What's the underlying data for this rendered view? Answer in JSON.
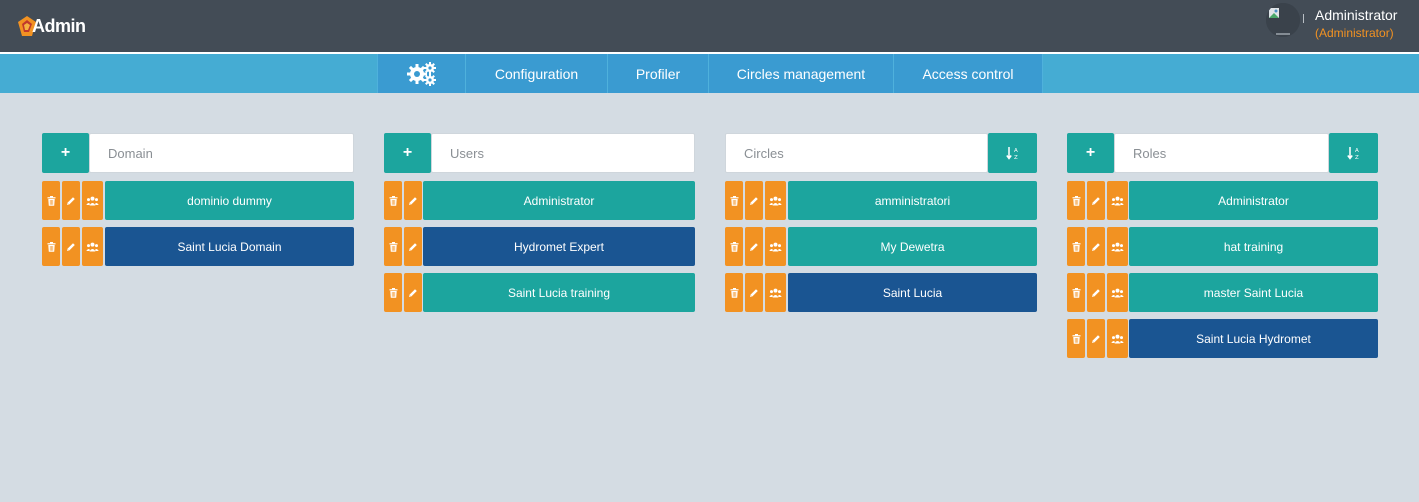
{
  "header": {
    "logo_text": "Admin",
    "user_name": "Administrator",
    "user_role": "(Administrator)"
  },
  "nav": {
    "gear_icon": "gears-icon",
    "items": [
      "Configuration",
      "Profiler",
      "Circles management",
      "Access control"
    ]
  },
  "columns": {
    "domain": {
      "placeholder": "Domain",
      "items": [
        {
          "label": "dominio dummy",
          "selected": false
        },
        {
          "label": "Saint Lucia Domain",
          "selected": true
        }
      ]
    },
    "users": {
      "placeholder": "Users",
      "items": [
        {
          "label": "Administrator",
          "selected": false
        },
        {
          "label": "Hydromet Expert",
          "selected": true
        },
        {
          "label": "Saint Lucia training",
          "selected": false
        }
      ]
    },
    "circles": {
      "placeholder": "Circles",
      "items": [
        {
          "label": "amministratori",
          "selected": false
        },
        {
          "label": "My Dewetra",
          "selected": false
        },
        {
          "label": "Saint Lucia",
          "selected": true
        }
      ]
    },
    "roles": {
      "placeholder": "Roles",
      "items": [
        {
          "label": "Administrator",
          "selected": false
        },
        {
          "label": "hat training",
          "selected": false
        },
        {
          "label": "master Saint Lucia",
          "selected": false
        },
        {
          "label": "Saint Lucia Hydromet",
          "selected": true
        }
      ]
    }
  },
  "buttons": {
    "add": "+"
  },
  "colors": {
    "header_bg": "#434c56",
    "nav_bg": "#45acd3",
    "teal": "#1ca59e",
    "navy": "#1a5592",
    "orange": "#f29222",
    "page_bg": "#d4dce3"
  }
}
